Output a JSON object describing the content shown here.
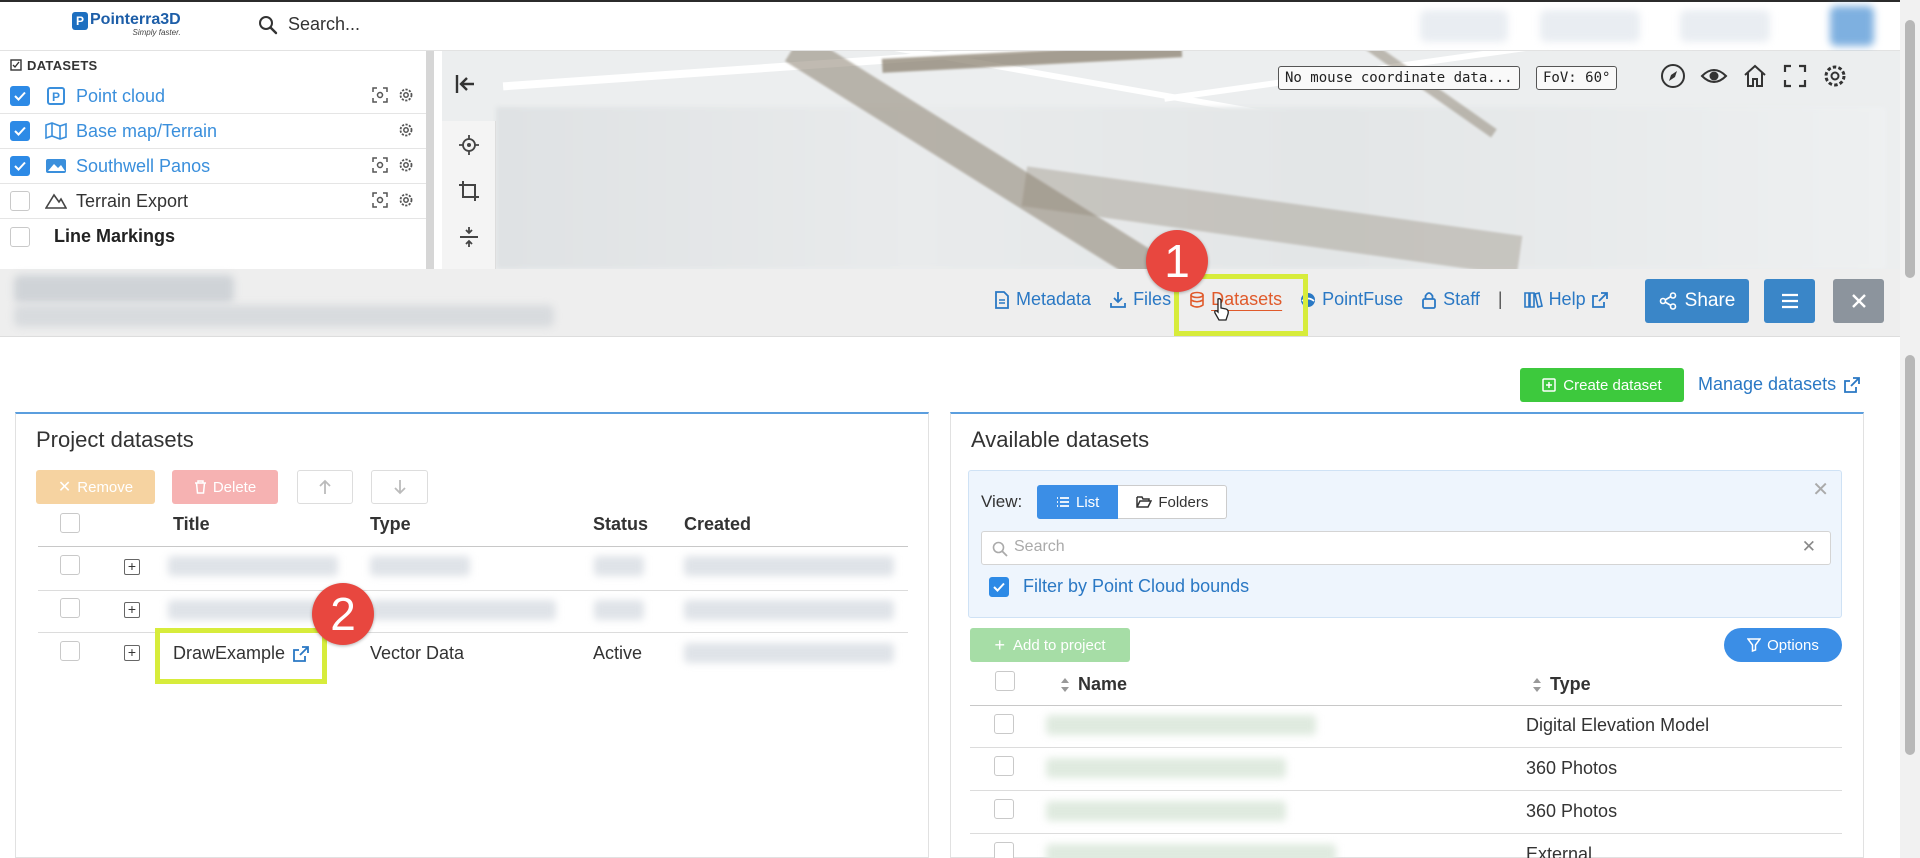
{
  "app": {
    "logo_name": "Pointerra3D",
    "logo_tagline": "Simply faster."
  },
  "topbar": {
    "search_label": "Search..."
  },
  "layers": {
    "header": "DATASETS",
    "items": [
      {
        "label": "Point cloud",
        "checked": true,
        "icon": "point-cloud-icon"
      },
      {
        "label": "Base map/Terrain",
        "checked": true,
        "icon": "map-icon"
      },
      {
        "label": "Southwell Panos",
        "checked": true,
        "icon": "panorama-icon"
      },
      {
        "label": "Terrain Export",
        "checked": false,
        "icon": "terrain-icon"
      },
      {
        "label": "Line Markings",
        "checked": false,
        "icon": "folder-icon"
      }
    ]
  },
  "map": {
    "coord_readout": "No mouse coordinate data...",
    "fov": "FoV: 60°"
  },
  "nav": {
    "metadata": "Metadata",
    "files": "Files",
    "datasets": "Datasets",
    "pointfuse": "PointFuse",
    "staff": "Staff",
    "separator": "|",
    "help": "Help",
    "share": "Share"
  },
  "callouts": {
    "one": "1",
    "two": "2"
  },
  "actions": {
    "create_dataset": "Create dataset",
    "manage_datasets": "Manage datasets"
  },
  "project_panel": {
    "title": "Project datasets",
    "remove": "Remove",
    "delete": "Delete",
    "columns": {
      "title": "Title",
      "type": "Type",
      "status": "Status",
      "created": "Created"
    },
    "rows": [
      {
        "title": "",
        "type": "",
        "status": "",
        "created": ""
      },
      {
        "title": "",
        "type": "",
        "status": "",
        "created": ""
      },
      {
        "title": "DrawExample",
        "type": "Vector Data",
        "status": "Active",
        "created": ""
      }
    ]
  },
  "available_panel": {
    "title": "Available datasets",
    "view_label": "View:",
    "view_list": "List",
    "view_folders": "Folders",
    "search_placeholder": "Search",
    "filter_label": "Filter by Point Cloud bounds",
    "add_to_project": "Add to project",
    "options": "Options",
    "columns": {
      "name": "Name",
      "type": "Type"
    },
    "rows": [
      {
        "name": "",
        "type": "Digital Elevation Model"
      },
      {
        "name": "",
        "type": "360 Photos"
      },
      {
        "name": "",
        "type": "360 Photos"
      },
      {
        "name": "",
        "type": "External"
      }
    ]
  },
  "colors": {
    "accent": "#3a86c8",
    "active_tab": "#e05a2b",
    "highlight": "#d7ec3b",
    "callout": "#e8473f",
    "create": "#3dc93d"
  }
}
